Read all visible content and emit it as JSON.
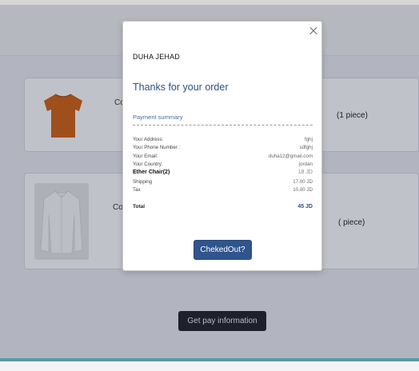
{
  "page": {
    "items": [
      {
        "name": "Co",
        "qty": "(1 piece)"
      },
      {
        "name": "Cot",
        "qty": "( piece)"
      }
    ],
    "pay_info_label": "Get pay information"
  },
  "modal": {
    "customer_name": "DUHA JEHAD",
    "thanks": "Thanks for your order",
    "summary_title": "Payment summary",
    "rows": [
      {
        "label": "Your Address:",
        "value": "fghj"
      },
      {
        "label": "Your Phone Number :",
        "value": "sdfghj"
      },
      {
        "label": "Your Email:",
        "value": "duha12@gmail.com"
      },
      {
        "label": "Your Country:",
        "value": "jordan"
      },
      {
        "label": "Ether Chair(2)",
        "value": "18 JD"
      },
      {
        "label": "Shipping",
        "value": "17.00 JD"
      },
      {
        "label": "Tax",
        "value": "10.00 JD"
      }
    ],
    "total": {
      "label": "Total",
      "value": "45 JD"
    },
    "checkout_label": "ChekedOut?"
  },
  "colors": {
    "accent": "#2f548e",
    "overlay": "#1e233c",
    "product_shirt": "#d2600f"
  }
}
